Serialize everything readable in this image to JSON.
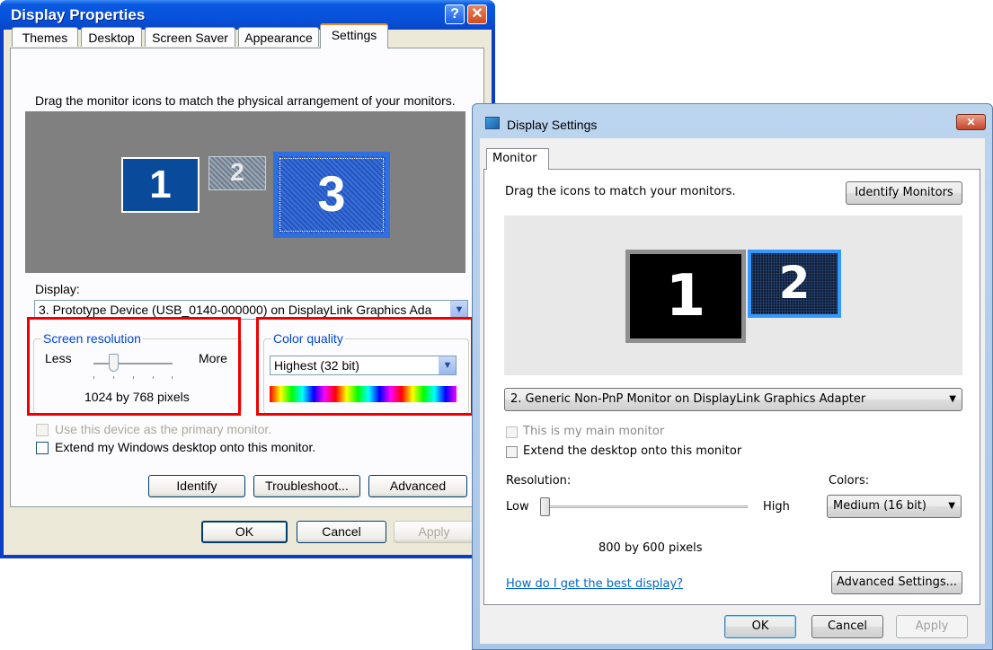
{
  "xp": {
    "title": "Display Properties",
    "help_glyph": "?",
    "close_glyph": "✕",
    "tabs": [
      {
        "label": "Themes"
      },
      {
        "label": "Desktop"
      },
      {
        "label": "Screen Saver"
      },
      {
        "label": "Appearance"
      },
      {
        "label": "Settings",
        "selected": true
      }
    ],
    "instruction": "Drag the monitor icons to match the physical arrangement of your monitors.",
    "monitors": [
      "1",
      "2",
      "3"
    ],
    "display_label": "Display:",
    "display_value": "3. Prototype Device (USB_0140-000000) on DisplayLink Graphics Ada",
    "screen_resolution": {
      "legend": "Screen resolution",
      "less": "Less",
      "more": "More",
      "value_text": "1024 by 768 pixels",
      "position": 0.25
    },
    "color_quality": {
      "legend": "Color quality",
      "value": "Highest (32 bit)"
    },
    "primary_checkbox": "Use this device as the primary monitor.",
    "extend_checkbox": "Extend my Windows desktop onto this monitor.",
    "buttons": {
      "identify": "Identify",
      "troubleshoot": "Troubleshoot...",
      "advanced": "Advanced",
      "ok": "OK",
      "cancel": "Cancel",
      "apply": "Apply"
    },
    "colors": {
      "title_bar": "#0a5ae0",
      "face": "#ece9d8",
      "accent_tab": "#e68b2c"
    }
  },
  "vista": {
    "title": "Display Settings",
    "close_glyph": "✕",
    "tab": "Monitor",
    "instruction": "Drag the icons to match your monitors.",
    "identify_button": "Identify Monitors",
    "monitors": [
      "1",
      "2"
    ],
    "display_value": "2. Generic Non-PnP Monitor on DisplayLink Graphics Adapter",
    "main_checkbox": "This is my main monitor",
    "extend_checkbox": "Extend the desktop onto this monitor",
    "resolution": {
      "label": "Resolution:",
      "low": "Low",
      "high": "High",
      "value_text": "800 by 600 pixels",
      "position": 0.0
    },
    "colors_label": "Colors:",
    "colors_value": "Medium (16 bit)",
    "help_link": "How do I get the best display?",
    "advanced_button": "Advanced Settings...",
    "buttons": {
      "ok": "OK",
      "cancel": "Cancel",
      "apply": "Apply"
    },
    "colors": {
      "selected_monitor": "#3399ff",
      "link": "#0066cc"
    }
  },
  "highlight_color": "#ee0000"
}
